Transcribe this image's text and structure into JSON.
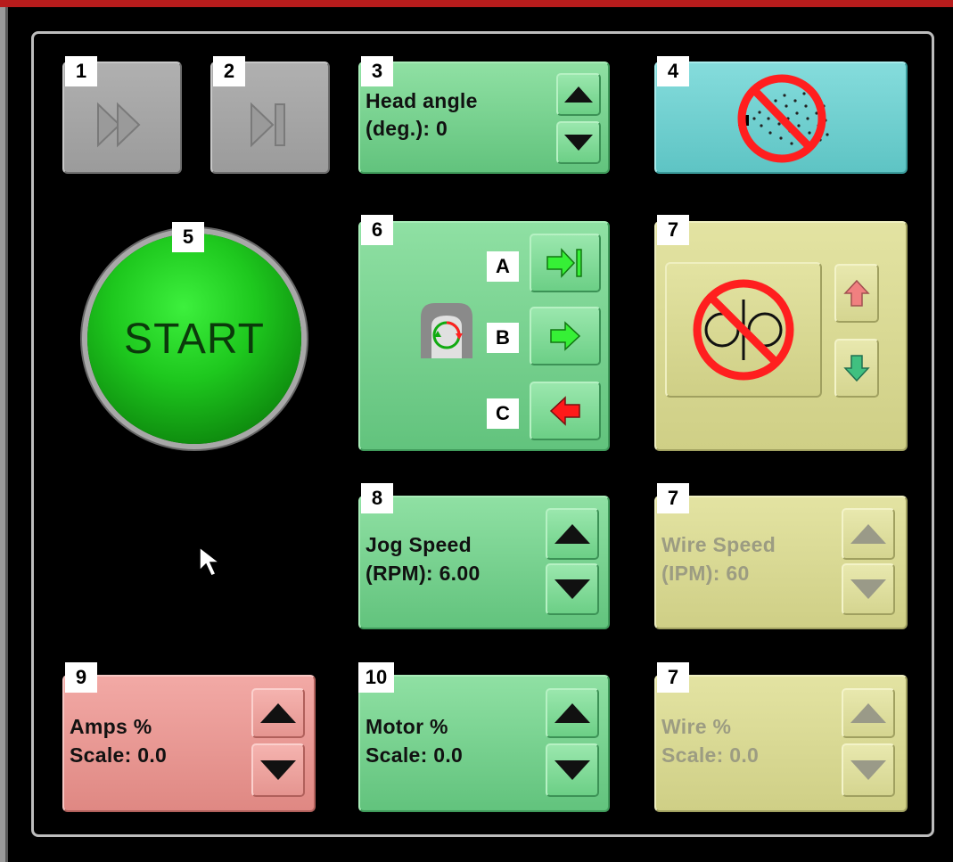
{
  "badges": {
    "b1": "1",
    "b2": "2",
    "b3": "3",
    "b4": "4",
    "b5": "5",
    "b6": "6",
    "b7a": "7",
    "b7b": "7",
    "b7c": "7",
    "b8": "8",
    "b9": "9",
    "b10": "10"
  },
  "sub_badges": {
    "a": "A",
    "b": "B",
    "c": "C"
  },
  "head_angle": {
    "line1": "Head angle",
    "line2": "(deg.): 0"
  },
  "start_label": "START",
  "jog_speed": {
    "line1": "Jog Speed",
    "line2": "(RPM): 6.00"
  },
  "wire_speed": {
    "line1": "Wire Speed",
    "line2": "(IPM): 60"
  },
  "amps_scale": {
    "line1": "Amps %",
    "line2": "Scale: 0.0"
  },
  "motor_scale": {
    "line1": "Motor %",
    "line2": "Scale: 0.0"
  },
  "wire_scale": {
    "line1": "Wire %",
    "line2": "Scale: 0.0"
  },
  "colors": {
    "green_button": "#7ad693",
    "teal_button": "#6fd0d0",
    "khaki_button": "#d9d98f",
    "pink_button": "#e8948f",
    "gray_button": "#a6a6a6",
    "start_green": "#1ec81e",
    "disabled_text": "#9c9c82"
  },
  "icons": {
    "btn1": "fast-forward-icon",
    "btn2": "skip-to-end-icon",
    "btn4": "no-spray-icon",
    "btn6": "rotation-icon",
    "btn7": "no-wire-spool-icon"
  }
}
